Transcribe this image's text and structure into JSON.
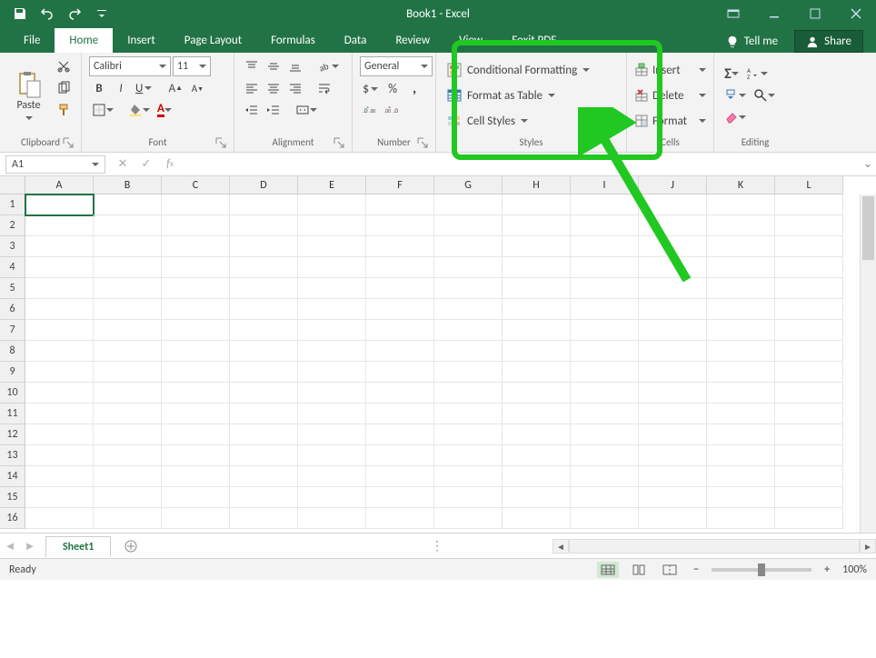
{
  "title": "Book1 - Excel",
  "tabs": {
    "file": "File",
    "home": "Home",
    "insert": "Insert",
    "page_layout": "Page Layout",
    "formulas": "Formulas",
    "data": "Data",
    "review": "Review",
    "view": "View",
    "foxit": "Foxit PDF"
  },
  "tellme_label": "Tell me",
  "share_label": "Share",
  "ribbon": {
    "clipboard": {
      "label": "Clipboard",
      "paste": "Paste"
    },
    "font": {
      "label": "Font",
      "name": "Calibri",
      "size": "11",
      "bold": "B",
      "italic": "I",
      "underline": "U"
    },
    "alignment": {
      "label": "Alignment"
    },
    "number": {
      "label": "Number",
      "format": "General"
    },
    "styles": {
      "label": "Styles",
      "cond_fmt": "Conditional Formatting",
      "fmt_table": "Format as Table",
      "cell_styles": "Cell Styles"
    },
    "cells": {
      "label": "Cells",
      "insert": "Insert",
      "delete": "Delete",
      "format": "Format"
    },
    "editing": {
      "label": "Editing"
    }
  },
  "namebox_value": "A1",
  "columns": [
    "A",
    "B",
    "C",
    "D",
    "E",
    "F",
    "G",
    "H",
    "I",
    "J",
    "K",
    "L"
  ],
  "rows": [
    "1",
    "2",
    "3",
    "4",
    "5",
    "6",
    "7",
    "8",
    "9",
    "10",
    "11",
    "12",
    "13",
    "14",
    "15",
    "16"
  ],
  "sheet_tab": "Sheet1",
  "status_text": "Ready",
  "zoom_pct": "100%"
}
